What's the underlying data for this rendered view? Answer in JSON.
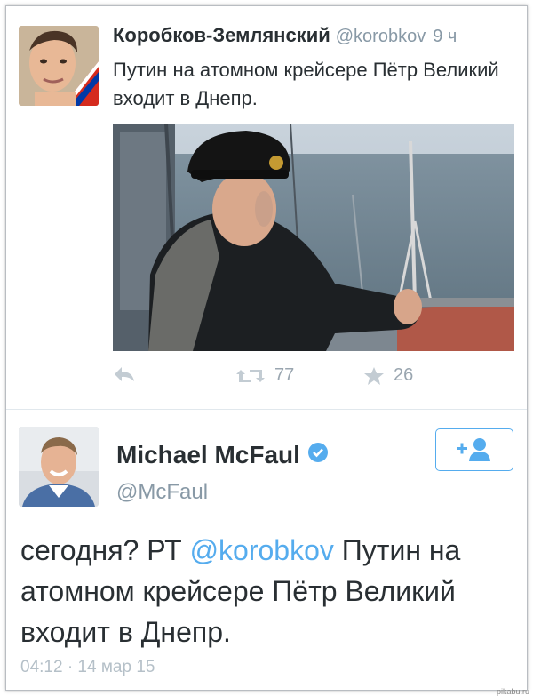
{
  "tweet1": {
    "name": "Коробков-Землянский",
    "handle": "@korobkov",
    "time": "9 ч",
    "text": "Путин на атомном крейсере Пётр Великий входит в Днепр.",
    "actions": {
      "reply_icon": "reply-icon",
      "retweet_icon": "retweet-icon",
      "retweet_count": "77",
      "favorite_icon": "star-icon",
      "favorite_count": "26"
    }
  },
  "tweet2": {
    "name": "Michael McFaul",
    "handle": "@McFaul",
    "verified_icon": "verified-badge-icon",
    "follow_icon": "add-user-icon",
    "text_before": "сегодня? РТ ",
    "mention": "@korobkov",
    "text_after": " Путин на атомном крейсере Пётр Великий входит в Днепр.",
    "date": "04:12 · 14 мар 15"
  },
  "watermark": "pikabu.ru",
  "colors": {
    "accent": "#55acee",
    "text": "#292f33",
    "muted": "#8899a6"
  }
}
